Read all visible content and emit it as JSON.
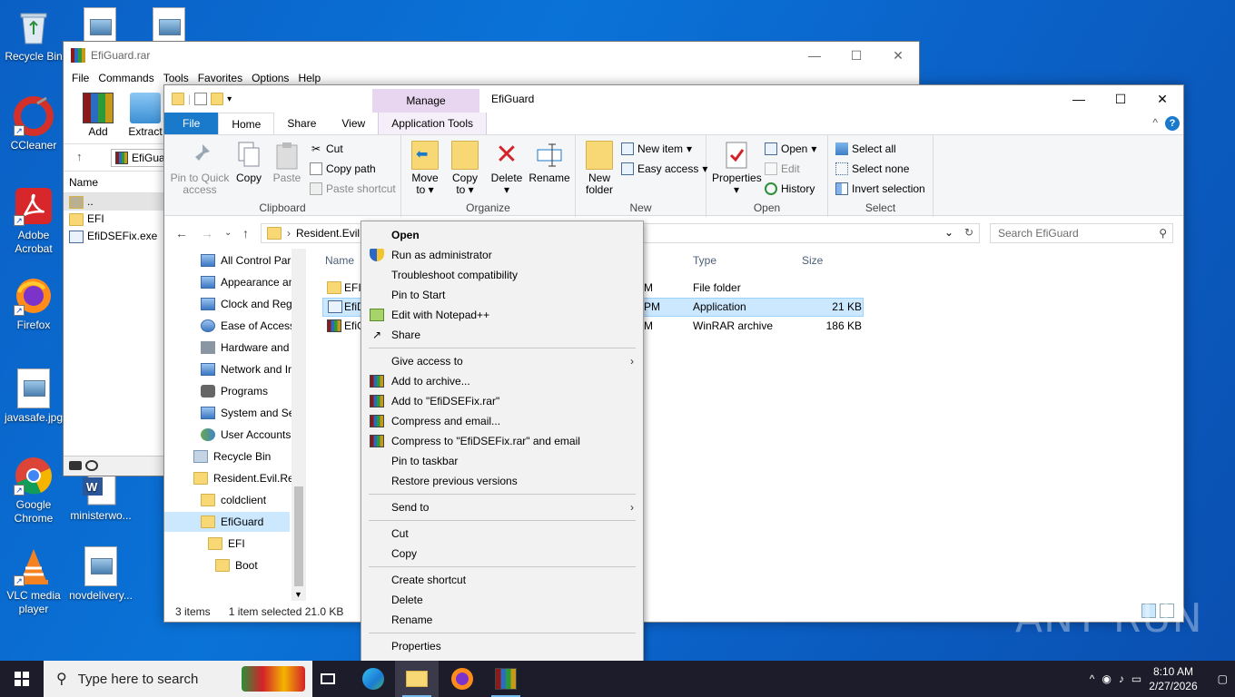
{
  "desktop": {
    "icons": [
      {
        "label": "Recycle Bin"
      },
      {
        "label": "CCleaner"
      },
      {
        "label": "Adobe Acrobat"
      },
      {
        "label": "Firefox"
      },
      {
        "label": "javasafe.jpg"
      },
      {
        "label": "Google Chrome"
      },
      {
        "label": "ministerwo..."
      },
      {
        "label": "VLC media player"
      },
      {
        "label": "novdelivery..."
      }
    ]
  },
  "winrar": {
    "title": "EfiGuard.rar",
    "menu": [
      "File",
      "Commands",
      "Tools",
      "Favorites",
      "Options",
      "Help"
    ],
    "tools": {
      "add": "Add",
      "extract": "Extract"
    },
    "address": "EfiGuar",
    "list_header": "Name",
    "rows": [
      "..",
      "EFI",
      "EfiDSEFix.exe"
    ]
  },
  "explorer": {
    "title": "EfiGuard",
    "manage": "Manage",
    "tabs": {
      "file": "File",
      "home": "Home",
      "share": "Share",
      "view": "View",
      "apptools": "Application Tools"
    },
    "clipboard": {
      "pin": "Pin to Quick access",
      "copy": "Copy",
      "paste": "Paste",
      "cut": "Cut",
      "copy_path": "Copy path",
      "paste_shortcut": "Paste shortcut",
      "label": "Clipboard"
    },
    "organize": {
      "move": "Move to",
      "copy_to": "Copy to",
      "delete": "Delete",
      "rename": "Rename",
      "label": "Organize"
    },
    "new": {
      "new_folder": "New folder",
      "new_item": "New item",
      "easy_access": "Easy access",
      "label": "New"
    },
    "open": {
      "properties": "Properties",
      "open": "Open",
      "edit": "Edit",
      "history": "History",
      "label": "Open"
    },
    "select": {
      "all": "Select all",
      "none": "Select none",
      "invert": "Invert selection",
      "label": "Select"
    },
    "address": "Resident.Evil.",
    "search_placeholder": "Search EfiGuard",
    "nav": [
      "All Control Par",
      "Appearance an",
      "Clock and Regi",
      "Ease of Access",
      "Hardware and",
      "Network and Ir",
      "Programs",
      "System and Sec",
      "User Accounts",
      "Recycle Bin",
      "Resident.Evil.Re",
      "coldclient",
      "EfiGuard",
      "EFI",
      "Boot"
    ],
    "columns": {
      "name": "Name",
      "type": "Type",
      "size": "Size"
    },
    "files": [
      {
        "name": "EFI",
        "date": "M",
        "type": "File folder",
        "size": ""
      },
      {
        "name": "EfiD",
        "date": "PM",
        "type": "Application",
        "size": "21 KB"
      },
      {
        "name": "EfiG",
        "date": "M",
        "type": "WinRAR archive",
        "size": "186 KB"
      }
    ],
    "status": {
      "items": "3 items",
      "selected": "1 item selected  21.0 KB"
    }
  },
  "context_menu": {
    "open": "Open",
    "run_admin": "Run as administrator",
    "troubleshoot": "Troubleshoot compatibility",
    "pin_start": "Pin to Start",
    "edit_npp": "Edit with Notepad++",
    "share": "Share",
    "give_access": "Give access to",
    "add_archive": "Add to archive...",
    "add_rar": "Add to \"EfiDSEFix.rar\"",
    "compress_email": "Compress and email...",
    "compress_rar_email": "Compress to \"EfiDSEFix.rar\" and email",
    "pin_taskbar": "Pin to taskbar",
    "restore": "Restore previous versions",
    "send_to": "Send to",
    "cut": "Cut",
    "copy": "Copy",
    "create_shortcut": "Create shortcut",
    "delete": "Delete",
    "rename": "Rename",
    "properties": "Properties"
  },
  "taskbar": {
    "search_placeholder": "Type here to search",
    "time": "8:10 AM",
    "date": "2/27/2026"
  },
  "watermark": "ANY RUN"
}
